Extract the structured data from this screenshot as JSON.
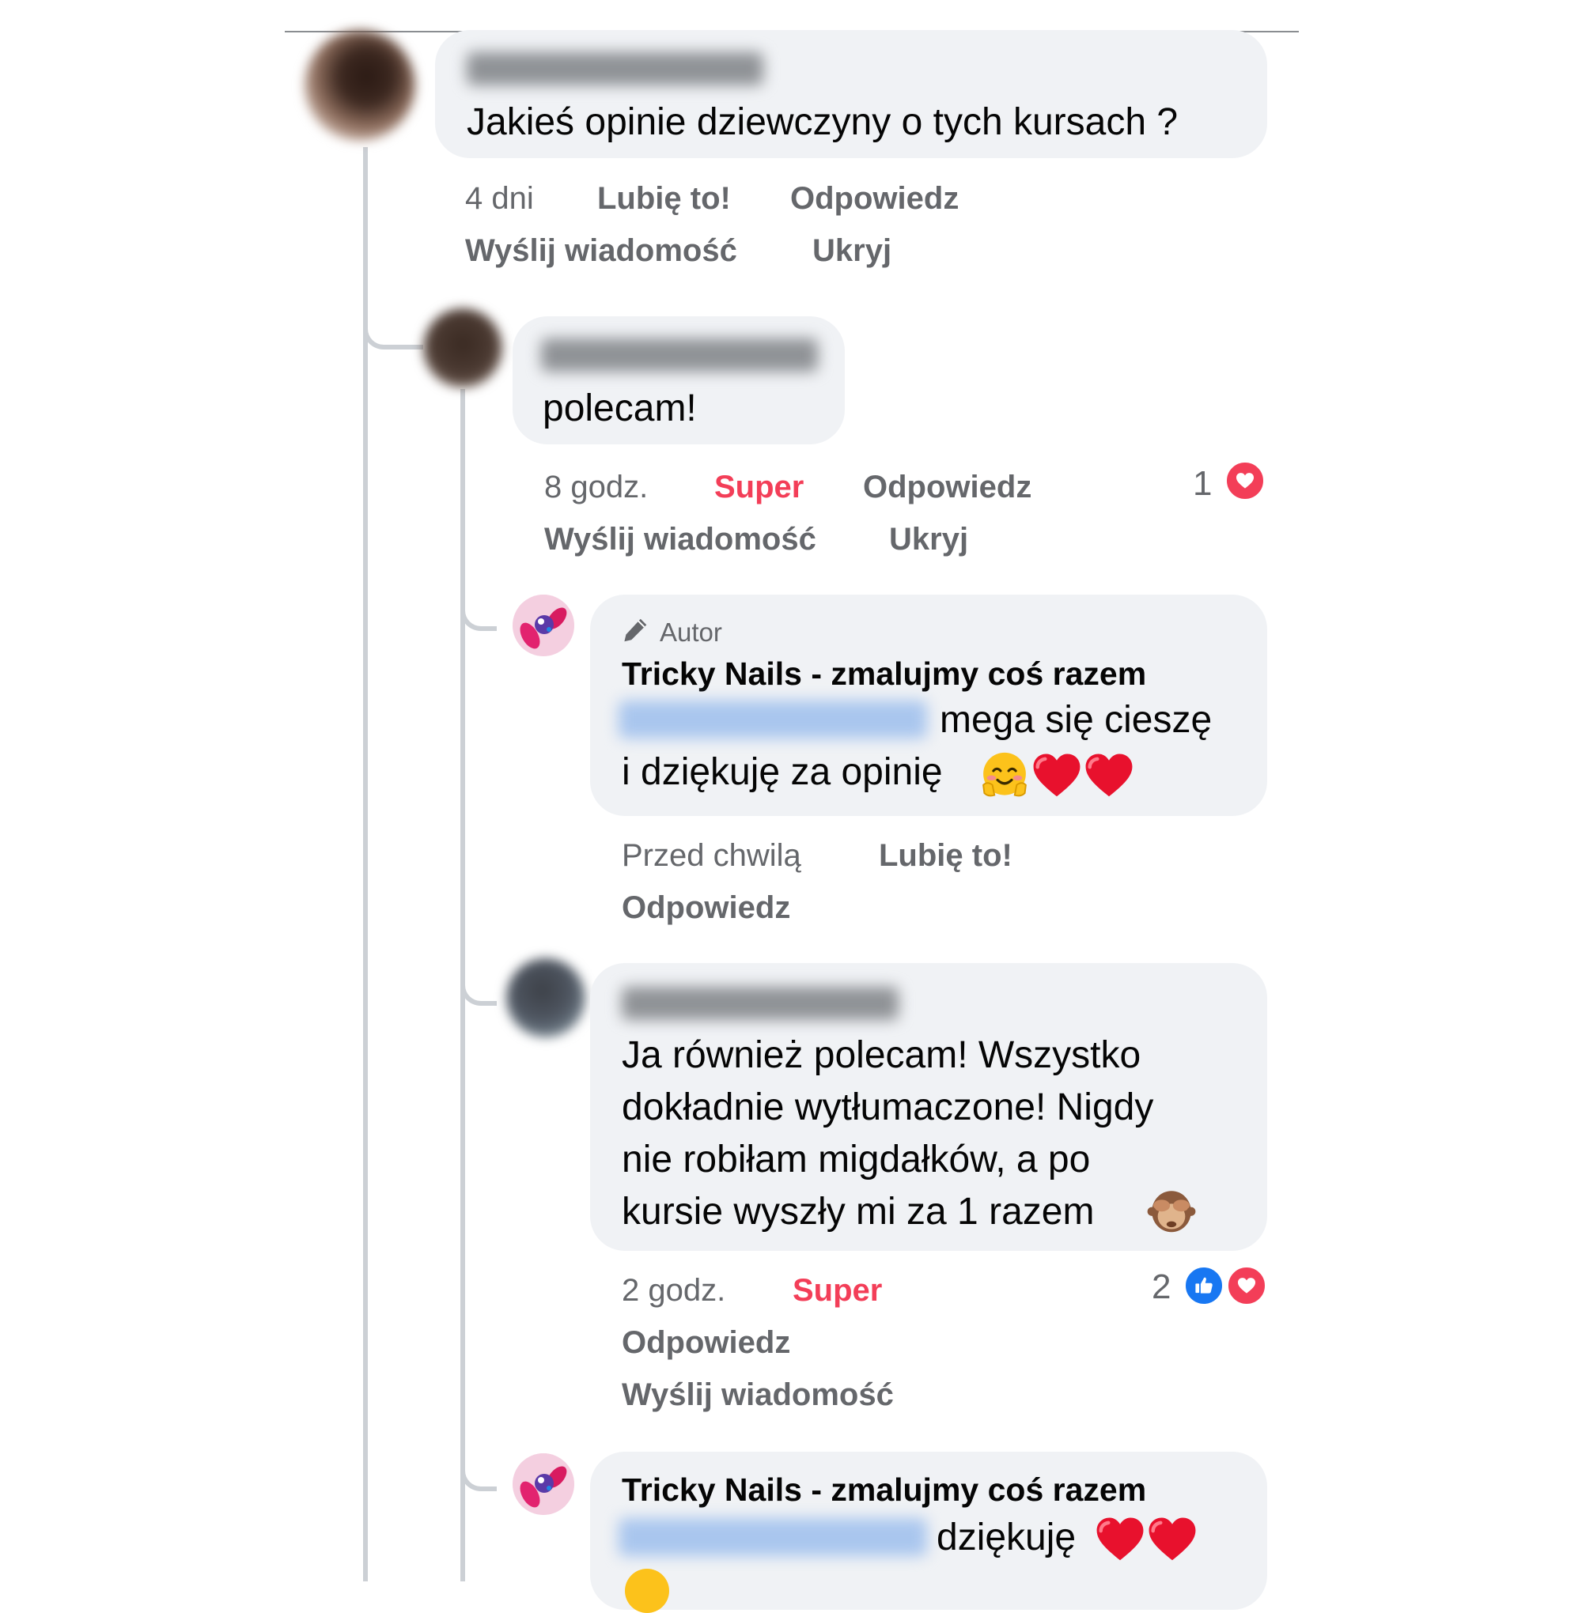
{
  "comments": [
    {
      "author_hidden": "Joanna Marczyk",
      "text": "Jakieś opinie dziewczyny o tych kursach ?",
      "time": "4 dni",
      "reaction_action": "Lubię to!",
      "reply": "Odpowiedz",
      "message": "Wyślij wiadomość",
      "hide": "Ukryj"
    },
    {
      "author_hidden": "Dominika Purgal",
      "text": "polecam!",
      "time": "8 godz.",
      "reaction_action": "Super",
      "reply": "Odpowiedz",
      "message": "Wyślij wiadomość",
      "hide": "Ukryj",
      "reaction_count": "1",
      "reaction_types": [
        "love-reaction"
      ],
      "reaction_color": "#f33e58"
    },
    {
      "badge": "Autor",
      "author": "Tricky Nails - zmalujmy coś razem",
      "mention_hidden": "Karolina Naruszek",
      "text_part1": "mega się cieszę",
      "text_part2": "i dziękuję za opinię",
      "emojis": [
        "hugging-face-emoji",
        "red-heart-emoji",
        "red-heart-emoji"
      ],
      "time": "Przed chwilą",
      "reaction_action": "Lubię to!",
      "reply": "Odpowiedz"
    },
    {
      "author_hidden": "Karolina Naruszek",
      "text_lines": [
        "Ja również polecam! Wszystko",
        "dokładnie wytłumaczone! Nigdy",
        "nie robiłam migdałków, a po",
        "kursie wyszły mi za 1 razem"
      ],
      "emojis": [
        "see-no-evil-monkey-emoji"
      ],
      "time": "2 godz.",
      "reaction_action": "Super",
      "reply": "Odpowiedz",
      "message": "Wyślij wiadomość",
      "reaction_count": "2",
      "reaction_types": [
        "like-reaction",
        "love-reaction"
      ]
    },
    {
      "author": "Tricky Nails - zmalujmy coś razem",
      "mention_hidden": "Dominika Purgal",
      "text": "dziękuję",
      "emojis": [
        "red-heart-emoji",
        "red-heart-emoji"
      ]
    }
  ],
  "colors": {
    "bubble": "#f0f2f5",
    "secondary_text": "#65676b",
    "super": "#f33e58",
    "like": "#1877f2",
    "mention": "#1877f2",
    "thread_line": "#ccd0d5"
  }
}
